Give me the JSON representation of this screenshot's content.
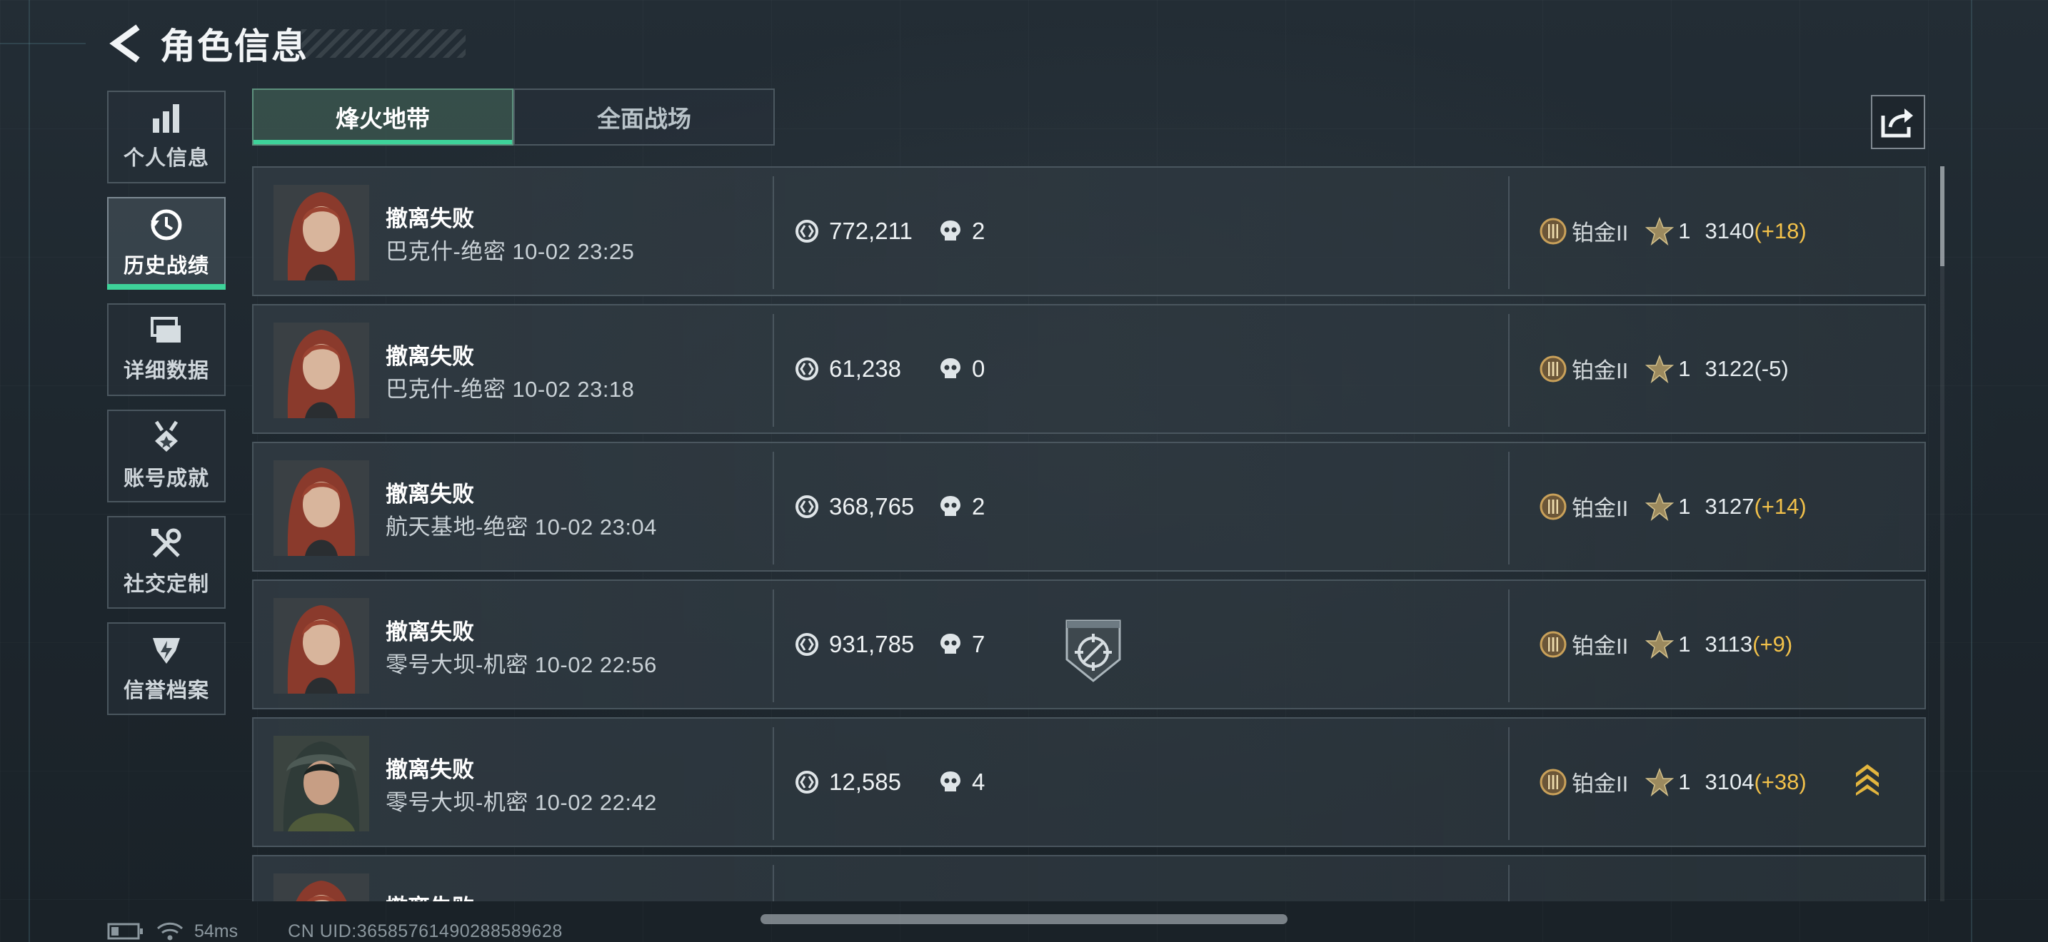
{
  "header": {
    "title": "角色信息"
  },
  "sidebar": {
    "items": [
      {
        "label": "个人信息",
        "icon": "bar-chart-icon"
      },
      {
        "label": "历史战绩",
        "icon": "history-clock-icon",
        "active": true
      },
      {
        "label": "详细数据",
        "icon": "stacked-cards-icon"
      },
      {
        "label": "账号成就",
        "icon": "medal-icon"
      },
      {
        "label": "社交定制",
        "icon": "wrench-screwdriver-icon"
      },
      {
        "label": "信誉档案",
        "icon": "reputation-badge-icon"
      }
    ]
  },
  "tabs": [
    {
      "label": "烽火地带",
      "active": true
    },
    {
      "label": "全面战场",
      "active": false
    }
  ],
  "share": {
    "icon": "share-icon"
  },
  "colors": {
    "accent": "#3ed39a",
    "delta_positive": "#f2c14a",
    "rank": "#c9a15a"
  },
  "matches": [
    {
      "result": "撤离失败",
      "map": "巴克什-绝密 10-02 23:25",
      "value": "772,211",
      "kills": "2",
      "rank_name": "铂金II",
      "stars": "1",
      "score": "3140",
      "delta": "(+18)",
      "delta_positive": true,
      "avatar": "red-hair-operator",
      "badge": null,
      "rank_up": false
    },
    {
      "result": "撤离失败",
      "map": "巴克什-绝密 10-02 23:18",
      "value": "61,238",
      "kills": "0",
      "rank_name": "铂金II",
      "stars": "1",
      "score": "3122",
      "delta": "(-5)",
      "delta_positive": false,
      "avatar": "red-hair-operator",
      "badge": null,
      "rank_up": false
    },
    {
      "result": "撤离失败",
      "map": "航天基地-绝密 10-02 23:04",
      "value": "368,765",
      "kills": "2",
      "rank_name": "铂金II",
      "stars": "1",
      "score": "3127",
      "delta": "(+14)",
      "delta_positive": true,
      "avatar": "red-hair-operator",
      "badge": null,
      "rank_up": false
    },
    {
      "result": "撤离失败",
      "map": "零号大坝-机密 10-02 22:56",
      "value": "931,785",
      "kills": "7",
      "rank_name": "铂金II",
      "stars": "1",
      "score": "3113",
      "delta": "(+9)",
      "delta_positive": true,
      "avatar": "red-hair-operator",
      "badge": "crosshair-shield-icon",
      "rank_up": false
    },
    {
      "result": "撤离失败",
      "map": "零号大坝-机密 10-02 22:42",
      "value": "12,585",
      "kills": "4",
      "rank_name": "铂金II",
      "stars": "1",
      "score": "3104",
      "delta": "(+38)",
      "delta_positive": true,
      "avatar": "hooded-operator",
      "badge": null,
      "rank_up": true
    },
    {
      "result": "撤离失败",
      "map": "",
      "value": "",
      "kills": "",
      "rank_name": "",
      "stars": "",
      "score": "",
      "delta": "",
      "delta_positive": true,
      "avatar": "red-hair-operator",
      "badge": null,
      "rank_up": false
    }
  ],
  "status_bar": {
    "ping": "54ms",
    "uid": "CN UID:36585761490288589628"
  }
}
